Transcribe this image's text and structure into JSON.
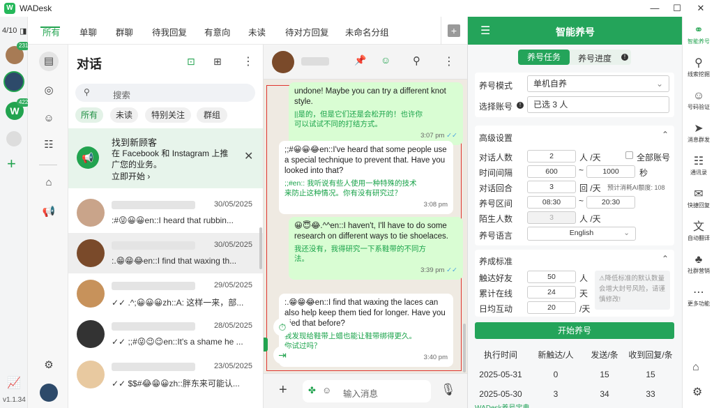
{
  "app": {
    "title": "WADesk",
    "version": "v1.1.34",
    "account_counter": "4/10"
  },
  "rail": {
    "badges": [
      "231",
      "422"
    ]
  },
  "tabs": [
    "所有",
    "单聊",
    "群聊",
    "待我回复",
    "有意向",
    "未读",
    "待对方回复",
    "未命名分组"
  ],
  "chatlist": {
    "title": "对话",
    "search_placeholder": "搜索",
    "filters": [
      "所有",
      "未读",
      "特别关注",
      "群组"
    ],
    "banner": {
      "title": "找到新顾客",
      "body": "在 Facebook 和 Instagram 上推广您的业务。",
      "cta": "立即开始 ›"
    },
    "rows": [
      {
        "date": "30/05/2025",
        "preview": ":#😜😀😀en::I heard that rubbin...",
        "av": "#c9a48a"
      },
      {
        "date": "30/05/2025",
        "preview": ":.😁😁😂en::I find that waxing th...",
        "av": "#7a4a2a"
      },
      {
        "date": "29/05/2025",
        "preview": "✓✓ .^;😀😀😀zh::A: 这样一来，部...",
        "av": "#c7925b"
      },
      {
        "date": "28/05/2025",
        "preview": "✓✓ ;;#😜😉😉en::It's a shame he ...",
        "av": "#333333"
      },
      {
        "date": "23/05/2025",
        "preview": "✓✓ $$#😂😁😀zh::胖东来可能认...",
        "av": "#e8c9a0"
      }
    ]
  },
  "messages": [
    {
      "dir": "out",
      "text": "undone! Maybe you can try a different knot style.",
      "tr": "||是的，但是它们还是会松开的！也许你可以试试不同的打结方式。",
      "time": "3:07 pm"
    },
    {
      "dir": "in",
      "text": ";;#😀😀😂en::I've heard that some people use a special technique to prevent that. Have you looked into that?",
      "tr": ";;#en:: 我听说有些人使用一种特殊的技术来防止这种情况。你有没有研究过？",
      "time": "3:08 pm"
    },
    {
      "dir": "out",
      "text": "😀😇😂.^^en::I haven't, I'll have to do some research on different ways to tie shoelaces.",
      "tr": "我还没有，我得研究一下系鞋带的不同方法。",
      "time": "3:39 pm"
    },
    {
      "dir": "in",
      "text": ":.😁😁😂en::I find that waxing the laces can also help keep them tied for longer. Have you tried that before?",
      "tr": "我发现给鞋带上蜡也能让鞋带绑得更久。你试过吗？",
      "time": "3:40 pm"
    }
  ],
  "composer": {
    "placeholder": "输入消息"
  },
  "panel": {
    "title": "智能养号",
    "seg": [
      "养号任务",
      "养号进度"
    ],
    "mode_label": "养号模式",
    "mode_value": "单机自养",
    "account_label": "选择账号",
    "account_value": "已选 3 人",
    "adv_title": "高级设置",
    "f1_label": "对话人数",
    "f1_val": "2",
    "f1_unit": "人 /天",
    "f1_check": "全部账号",
    "f2_label": "时间间隔",
    "f2_a": "600",
    "f2_b": "1000",
    "f2_unit": "秒",
    "f3_label": "对话回合",
    "f3_val": "3",
    "f3_unit": "回 /天",
    "f3_note": "预计消耗AI额度: 108",
    "f4_label": "养号区间",
    "f4_a": "08:30",
    "f4_b": "20:30",
    "f5_label": "陌生人数",
    "f5_val": "3",
    "f5_unit": "人 /天",
    "f6_label": "养号语言",
    "f6_val": "English",
    "std_title": "养成标准",
    "s1_label": "触达好友",
    "s1_val": "50",
    "s1_unit": "人",
    "s2_label": "累计在线",
    "s2_val": "24",
    "s2_unit": "天",
    "s3_label": "日均互动",
    "s3_val": "20",
    "s3_unit": "/天",
    "tip": "⚠降低标准的默认数量会增大封号风险，请谨慎修改!",
    "start_btn": "开始养号",
    "table_headers": [
      "执行时间",
      "新触达/人",
      "发送/条",
      "收到回复/条"
    ],
    "table_rows": [
      [
        "2025-05-31",
        "0",
        "15",
        "15"
      ],
      [
        "2025-05-30",
        "3",
        "34",
        "33"
      ]
    ],
    "footer": "WADesk养号宝典"
  },
  "sidebar": [
    {
      "label": "智能养号",
      "g": "⚭"
    },
    {
      "label": "线索挖掘",
      "g": "⚲"
    },
    {
      "label": "号码验证",
      "g": "☺"
    },
    {
      "label": "消息群发",
      "g": "➤"
    },
    {
      "label": "通讯录",
      "g": "☷"
    },
    {
      "label": "快捷回复",
      "g": "✉"
    },
    {
      "label": "自动翻译",
      "g": "文"
    },
    {
      "label": "社群营销",
      "g": "♣"
    },
    {
      "label": "更多功能",
      "g": "⋯"
    }
  ]
}
